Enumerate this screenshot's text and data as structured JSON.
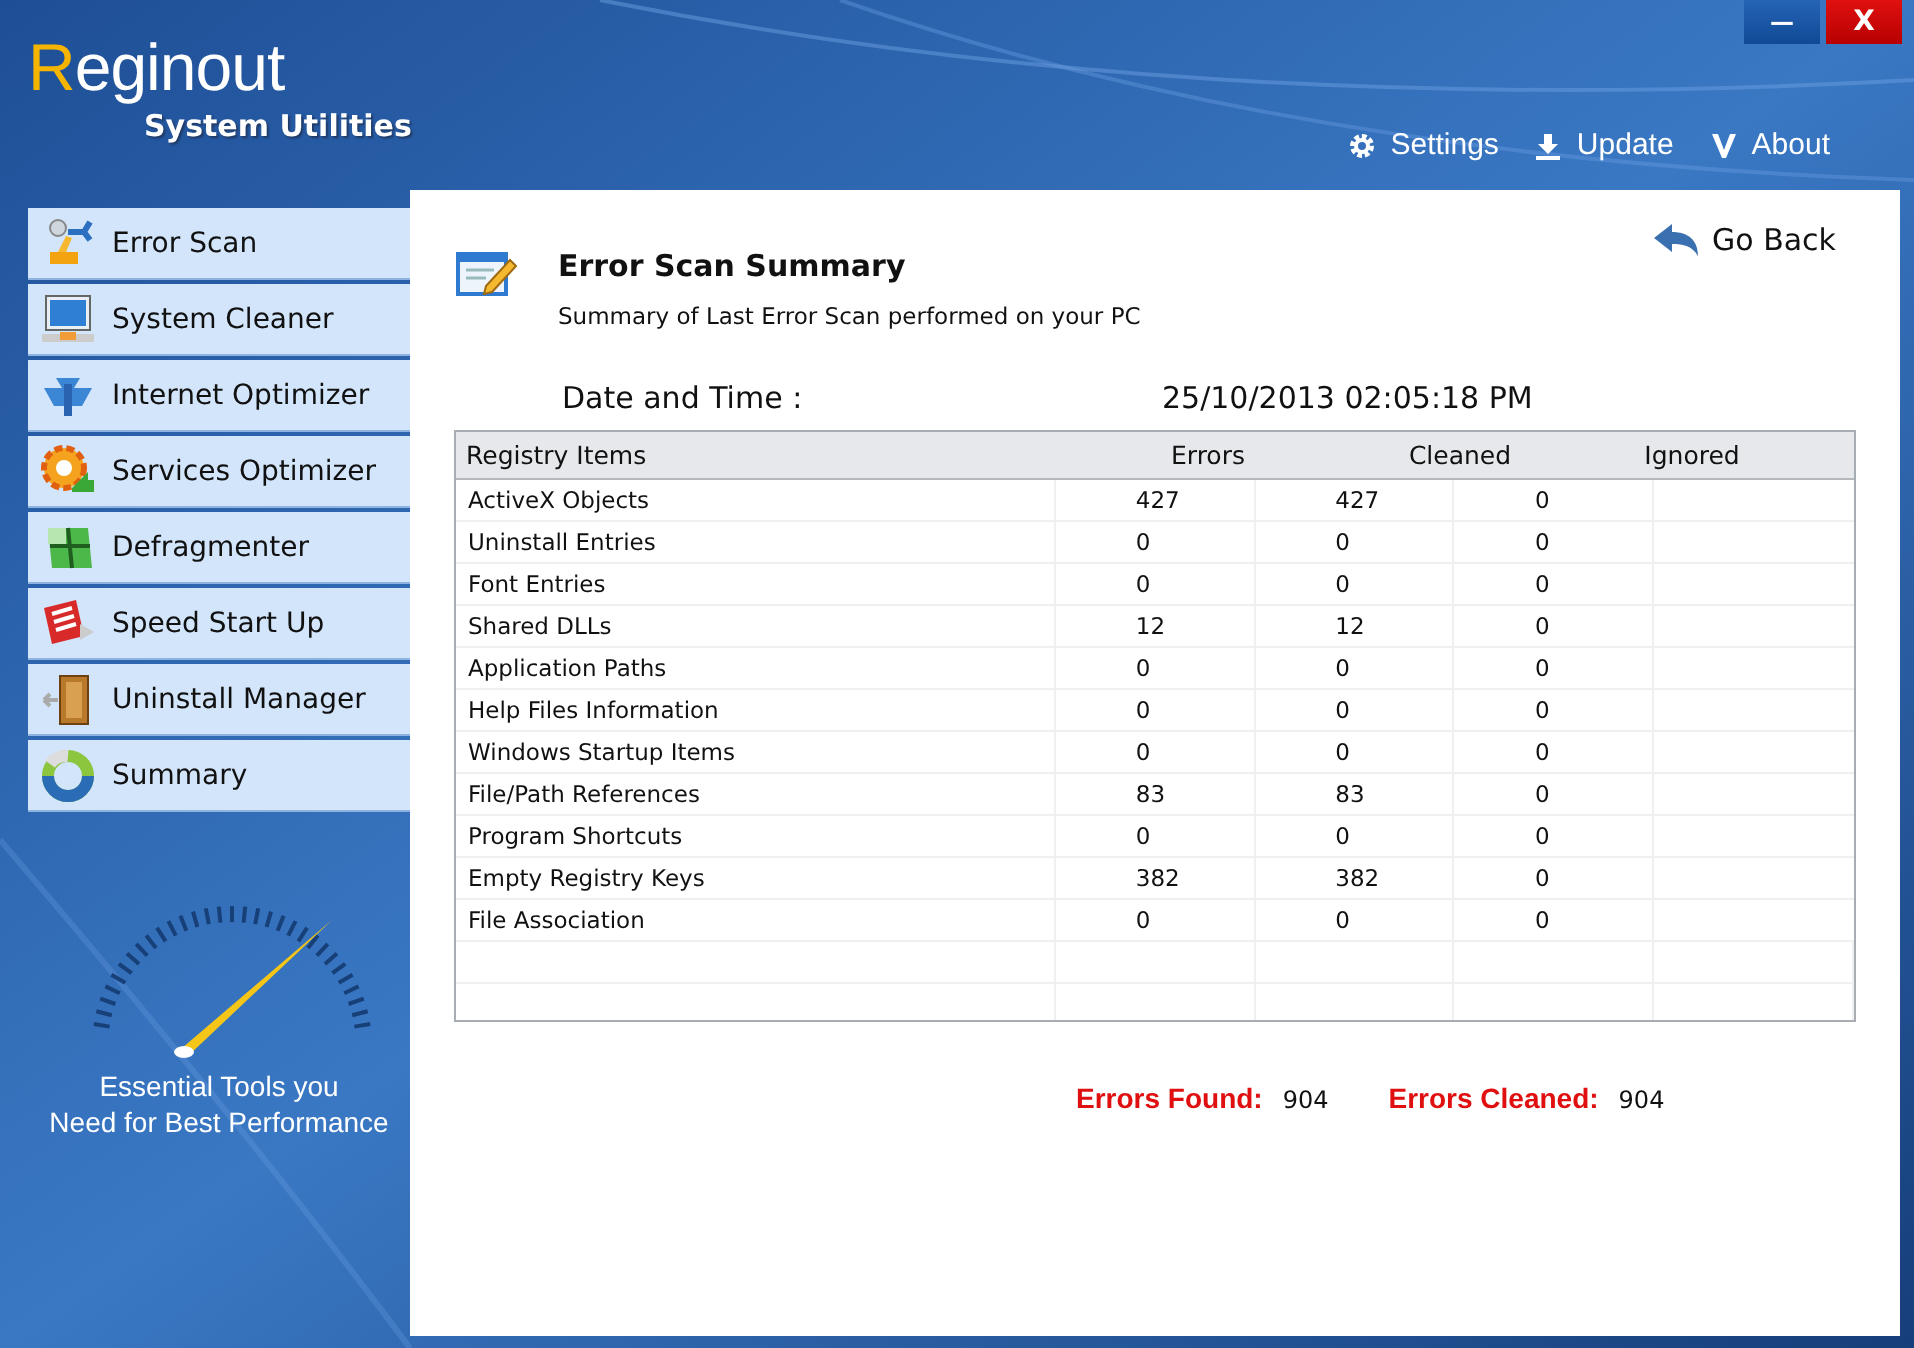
{
  "app": {
    "name_first": "R",
    "name_rest": "eginout",
    "subtitle": "System Utilities"
  },
  "window_buttons": [
    {
      "kind": "minimize",
      "label": "—"
    },
    {
      "kind": "close",
      "label": "X"
    }
  ],
  "top_menu": [
    {
      "kind": "settings",
      "label": "Settings"
    },
    {
      "kind": "update",
      "label": "Update"
    },
    {
      "kind": "about",
      "label": "About"
    }
  ],
  "sidebar": {
    "items": [
      {
        "label": "Error Scan"
      },
      {
        "label": "System Cleaner"
      },
      {
        "label": "Internet Optimizer"
      },
      {
        "label": "Services Optimizer"
      },
      {
        "label": "Defragmenter"
      },
      {
        "label": "Speed Start Up"
      },
      {
        "label": "Uninstall Manager"
      },
      {
        "label": "Summary"
      }
    ],
    "tagline": [
      "Essential Tools you",
      "Need for Best Performance"
    ]
  },
  "content": {
    "title": "Error Scan Summary",
    "subtitle": "Summary of Last Error Scan performed on your PC",
    "back": "Go Back",
    "date_label": "Date and Time :",
    "date_value": "25/10/2013 02:05:18 PM",
    "table": {
      "columns": [
        "Registry Items",
        "Errors",
        "Cleaned",
        "Ignored"
      ],
      "rows": [
        [
          "ActiveX Objects",
          "427",
          "427",
          "0"
        ],
        [
          "Uninstall Entries",
          "0",
          "0",
          "0"
        ],
        [
          "Font Entries",
          "0",
          "0",
          "0"
        ],
        [
          "Shared DLLs",
          "12",
          "12",
          "0"
        ],
        [
          "Application Paths",
          "0",
          "0",
          "0"
        ],
        [
          "Help Files Information",
          "0",
          "0",
          "0"
        ],
        [
          "Windows Startup Items",
          "0",
          "0",
          "0"
        ],
        [
          "File/Path References",
          "83",
          "83",
          "0"
        ],
        [
          "Program Shortcuts",
          "0",
          "0",
          "0"
        ],
        [
          "Empty Registry Keys",
          "382",
          "382",
          "0"
        ],
        [
          "File Association",
          "0",
          "0",
          "0"
        ]
      ]
    },
    "totals": [
      {
        "label": "Errors Found:",
        "value": "904"
      },
      {
        "label": "Errors Cleaned:",
        "value": "904"
      }
    ]
  }
}
